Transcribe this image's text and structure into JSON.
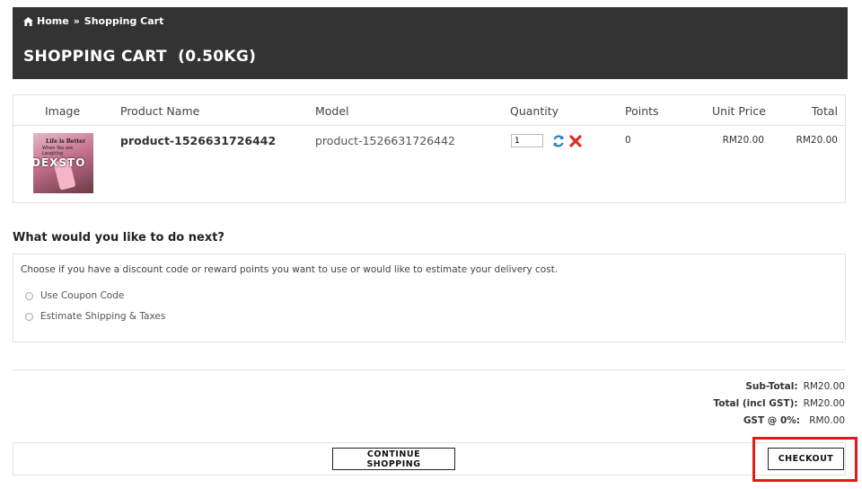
{
  "breadcrumb": {
    "home": "Home",
    "separator": "»",
    "current": "Shopping Cart"
  },
  "page_title": "SHOPPING CART  (0.50KG)",
  "cart": {
    "columns": [
      "Image",
      "Product Name",
      "Model",
      "Quantity",
      "Points",
      "Unit Price",
      "Total"
    ],
    "items": [
      {
        "product_name": "product-1526631726442",
        "model": "product-1526631726442",
        "quantity": "1",
        "points": "0",
        "unit_price": "RM20.00",
        "total": "RM20.00",
        "thumb_text_top": "Life is Better",
        "thumb_text_sub": "When You are Laughing",
        "thumb_watermark": "DEXSTO"
      }
    ],
    "update_icon": "refresh-icon",
    "remove_icon": "remove-x-icon"
  },
  "next": {
    "heading": "What would you like to do next?",
    "description": "Choose if you have a discount code or reward points you want to use or would like to estimate your delivery cost.",
    "options": [
      "Use Coupon Code",
      "Estimate Shipping & Taxes"
    ]
  },
  "totals": [
    {
      "label": "Sub-Total:",
      "value": "RM20.00"
    },
    {
      "label": "Total (incl GST):",
      "value": "RM20.00"
    },
    {
      "label": "GST @ 0%:",
      "value": "RM0.00"
    }
  ],
  "actions": {
    "continue_label": "CONTINUE SHOPPING",
    "checkout_label": "CHECKOUT"
  },
  "colors": {
    "header_bg": "#333333",
    "highlight": "#e01b1b",
    "refresh_icon": "#2a7fc1",
    "remove_icon": "#d9302c"
  }
}
